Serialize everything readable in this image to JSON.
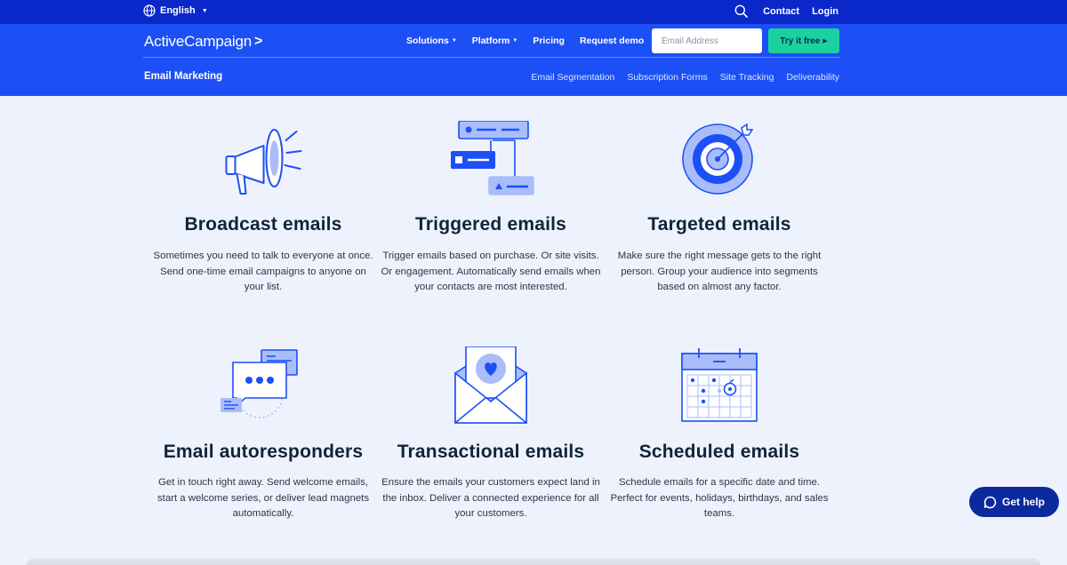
{
  "topbar": {
    "language": "English",
    "links": [
      "Contact",
      "Login"
    ]
  },
  "nav": {
    "logo": "ActiveCampaign",
    "links": [
      {
        "label": "Solutions",
        "dropdown": true
      },
      {
        "label": "Platform",
        "dropdown": true
      },
      {
        "label": "Pricing",
        "dropdown": false
      },
      {
        "label": "Request demo",
        "dropdown": false
      }
    ],
    "email_placeholder": "Email Address",
    "cta": "Try it free"
  },
  "subnav": {
    "title": "Email Marketing",
    "links": [
      "Email Segmentation",
      "Subscription Forms",
      "Site Tracking",
      "Deliverability"
    ]
  },
  "features": [
    {
      "title": "Broadcast emails",
      "description": "Sometimes you need to talk to everyone at once. Send one-time email campaigns to anyone on your list.",
      "icon": "megaphone-icon"
    },
    {
      "title": "Triggered emails",
      "description": "Trigger emails based on purchase. Or site visits. Or engagement. Automatically send emails when your contacts are most interested.",
      "icon": "workflow-icon"
    },
    {
      "title": "Targeted emails",
      "description": "Make sure the right message gets to the right person. Group your audience into segments based on almost any factor.",
      "icon": "target-icon"
    },
    {
      "title": "Email autoresponders",
      "description": "Get in touch right away. Send welcome emails, start a welcome series, or deliver lead magnets automatically.",
      "icon": "chat-bubbles-icon"
    },
    {
      "title": "Transactional emails",
      "description": "Ensure the emails your customers expect land in the inbox. Deliver a connected experience for all your customers.",
      "icon": "envelope-heart-icon"
    },
    {
      "title": "Scheduled emails",
      "description": "Schedule emails for a specific date and time. Perfect for events, holidays, birthdays, and sales teams.",
      "icon": "calendar-icon"
    }
  ],
  "help": {
    "label": "Get help"
  },
  "colors": {
    "topbar": "#0a28c9",
    "nav": "#1c4ff5",
    "cta": "#1bd1a0",
    "page_bg": "#eef2fd",
    "icon_blue": "#1c4ff5",
    "icon_light": "#a9bdfb"
  }
}
